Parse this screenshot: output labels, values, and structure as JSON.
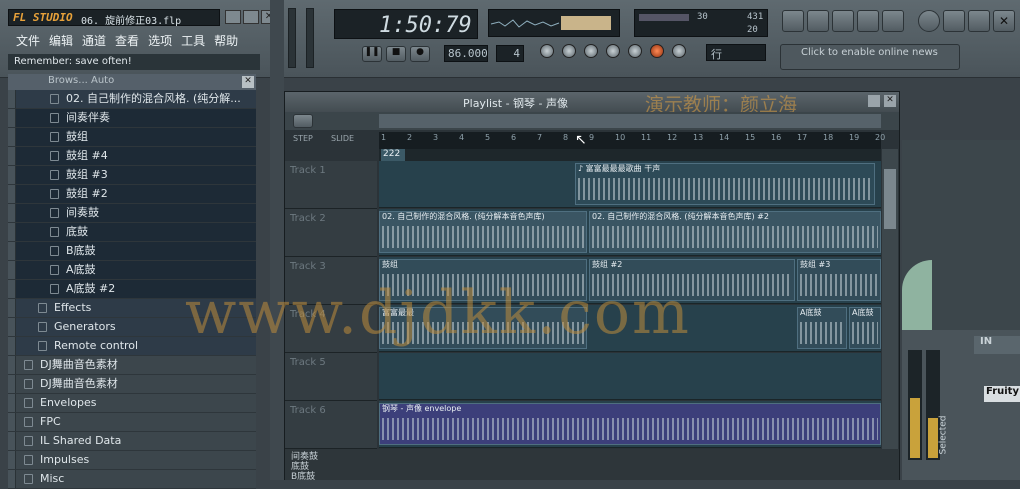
{
  "title_bar": {
    "logo": "FL STUDIO",
    "project": "06. 旋前修正03.flp"
  },
  "menu": [
    "文件",
    "编辑",
    "通道",
    "查看",
    "选项",
    "工具",
    "帮助"
  ],
  "hint": "Remember: save often!",
  "transport": {
    "time": "1:50:79",
    "tempo": "86.000",
    "pattern": "4",
    "monitor": "30",
    "cpu": "431",
    "poly": "20",
    "pat_label": "行"
  },
  "news": "Click to enable online news",
  "browser": {
    "header": "Brows... Auto",
    "top_item": "02. 自己制作的混合风格. (纯分解...",
    "items": [
      "间奏伴奏",
      "鼓组",
      "鼓组 #4",
      "鼓组 #3",
      "鼓组 #2",
      "间奏鼓",
      "底鼓",
      "B底鼓",
      "A底鼓",
      "A底鼓 #2"
    ],
    "folders": [
      "Effects",
      "Generators",
      "Remote control",
      "DJ舞曲音色素材",
      "DJ舞曲音色素材",
      "Envelopes",
      "FPC",
      "IL Shared Data",
      "Impulses",
      "Misc"
    ]
  },
  "playlist": {
    "title": "Playlist - 钢琴 - 声像",
    "watermark_top": "演示教师：颜立海",
    "step_label": "STEP",
    "slide_label": "SLIDE",
    "marker": "222",
    "ruler": [
      "1",
      "2",
      "3",
      "4",
      "5",
      "6",
      "7",
      "8",
      "9",
      "10",
      "11",
      "12",
      "13",
      "14",
      "15",
      "16",
      "17",
      "18",
      "19",
      "20"
    ],
    "tracks": [
      "Track 1",
      "Track 2",
      "Track 3",
      "Track 4",
      "Track 5",
      "Track 6"
    ],
    "bottom_names": [
      "间奏鼓",
      "底鼓",
      "B底鼓"
    ],
    "patterns": {
      "t1": "♪ 富富最最最歌曲 干声",
      "t2a": "02. 自己制作的混合风格. (纯分解本音色声库)",
      "t2b": "02. 自己制作的混合风格. (纯分解本音色声库) #2",
      "t3a": "鼓组",
      "t3b": "鼓组 #2",
      "t3c": "鼓组 #3",
      "t4a": "富富最最",
      "t4b": "A底鼓",
      "t4c": "A底鼓",
      "t6": "钢琴 - 声像 envelope"
    }
  },
  "watermark": "www.djdkk.com",
  "mixer": {
    "selected": "Selected",
    "fruity": "Fruity"
  }
}
